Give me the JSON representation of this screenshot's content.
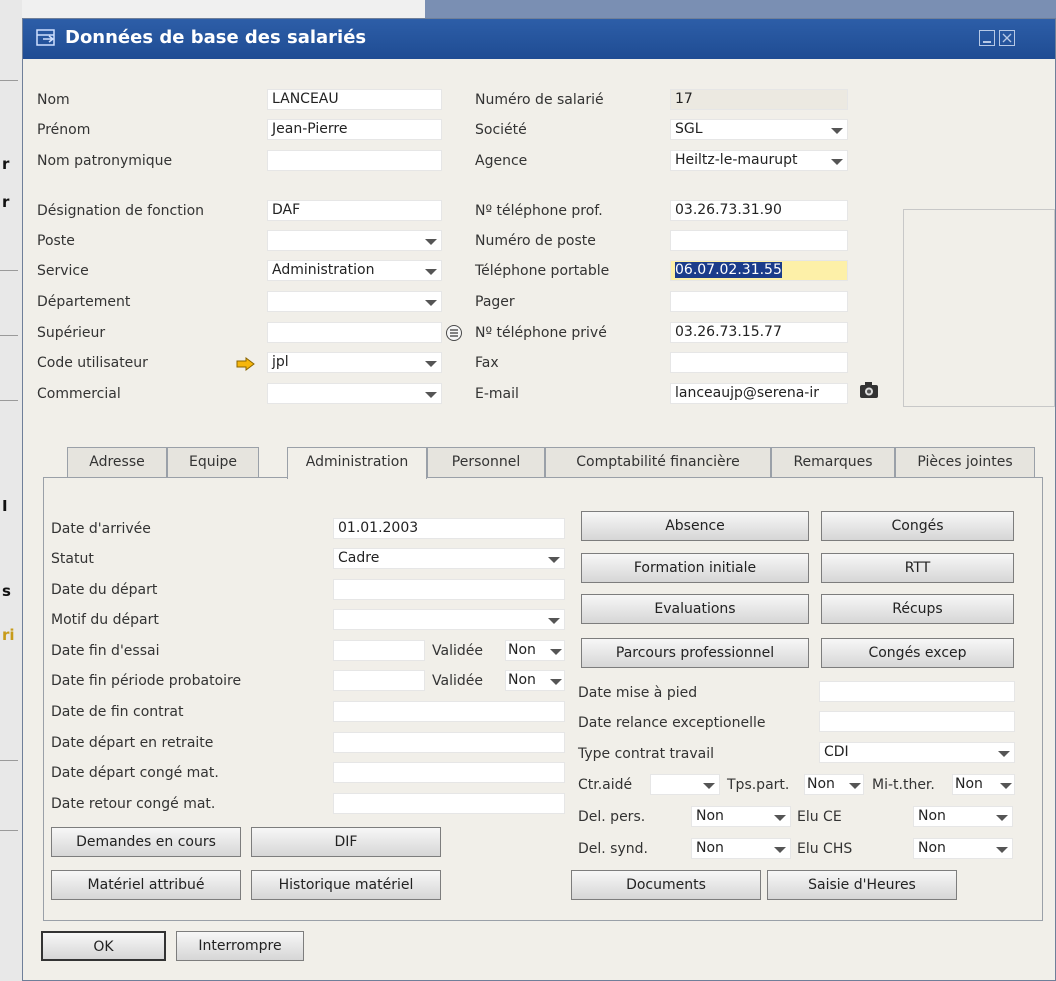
{
  "window": {
    "title": "Données de base des salariés"
  },
  "background": {
    "side_chars": [
      "r",
      "r",
      "I",
      "s",
      "ri"
    ]
  },
  "header_left": [
    {
      "label": "Nom",
      "value": "LANCEAU",
      "type": "text"
    },
    {
      "label": "Prénom",
      "value": "Jean-Pierre",
      "type": "text"
    },
    {
      "label": "Nom patronymique",
      "value": "",
      "type": "text"
    },
    {
      "label": "Désignation de fonction",
      "value": "DAF",
      "type": "text"
    },
    {
      "label": "Poste",
      "value": "",
      "type": "select"
    },
    {
      "label": "Service",
      "value": "Administration",
      "type": "select"
    },
    {
      "label": "Département",
      "value": "",
      "type": "select"
    },
    {
      "label": "Supérieur",
      "value": "",
      "type": "text"
    },
    {
      "label": "Code utilisateur",
      "value": "jpl",
      "type": "select"
    },
    {
      "label": "Commercial",
      "value": "",
      "type": "select"
    }
  ],
  "header_right": [
    {
      "label": "Numéro de salarié",
      "value": "17",
      "type": "readonly"
    },
    {
      "label": "Société",
      "value": "SGL",
      "type": "select"
    },
    {
      "label": "Agence",
      "value": "Heiltz-le-maurupt",
      "type": "select"
    },
    {
      "label": "Nº téléphone prof.",
      "value": "03.26.73.31.90",
      "type": "text"
    },
    {
      "label": "Numéro de poste",
      "value": "",
      "type": "text"
    },
    {
      "label": "Téléphone portable",
      "value": "06.07.02.31.55",
      "type": "highlight"
    },
    {
      "label": "Pager",
      "value": "",
      "type": "text"
    },
    {
      "label": "Nº téléphone privé",
      "value": "03.26.73.15.77",
      "type": "text"
    },
    {
      "label": "Fax",
      "value": "",
      "type": "text"
    },
    {
      "label": "E-mail",
      "value": "lanceaujp@serena-ir",
      "type": "text"
    }
  ],
  "tabs": [
    "Adresse",
    "Equipe",
    "Administration",
    "Personnel",
    "Comptabilité financière",
    "Remarques",
    "Pièces jointes"
  ],
  "active_tab": "Administration",
  "admin_left": [
    {
      "label": "Date d'arrivée",
      "value": "01.01.2003"
    },
    {
      "label": "Statut",
      "value": "Cadre"
    },
    {
      "label": "Date du départ",
      "value": ""
    },
    {
      "label": "Motif du départ",
      "value": ""
    },
    {
      "label": "Date fin d'essai",
      "value": ""
    },
    {
      "label": "Date fin période probatoire",
      "value": ""
    },
    {
      "label": "Date de fin contrat",
      "value": ""
    },
    {
      "label": "Date départ en retraite",
      "value": ""
    },
    {
      "label": "Date départ congé mat.",
      "value": ""
    },
    {
      "label": "Date retour congé mat.",
      "value": ""
    }
  ],
  "validee_label": "Validée",
  "validee_value": "Non",
  "admin_buttons_left": [
    "Demandes en cours",
    "DIF",
    "Matériel attribué",
    "Historique matériel"
  ],
  "admin_buttons_right": [
    "Absence",
    "Congés",
    "Formation initiale",
    "RTT",
    "Evaluations",
    "Récups",
    "Parcours professionnel",
    "Congés excep"
  ],
  "admin_right_fields": [
    {
      "label": "Date mise à pied",
      "value": ""
    },
    {
      "label": "Date relance exceptionelle",
      "value": ""
    },
    {
      "label": "Type contrat travail",
      "value": "CDI"
    }
  ],
  "flags": {
    "ctr_aide_label": "Ctr.aidé",
    "ctr_aide_value": "",
    "tps_part_label": "Tps.part.",
    "tps_part_value": "Non",
    "mi_t_ther_label": "Mi-t.ther.",
    "mi_t_ther_value": "Non",
    "del_pers_label": "Del. pers.",
    "del_pers_value": "Non",
    "elu_ce_label": "Elu CE",
    "elu_ce_value": "Non",
    "del_synd_label": "Del. synd.",
    "del_synd_value": "Non",
    "elu_chs_label": "Elu CHS",
    "elu_chs_value": "Non"
  },
  "bottom_right_buttons": [
    "Documents",
    "Saisie d'Heures"
  ],
  "footer": {
    "ok": "OK",
    "cancel": "Interrompre"
  },
  "colors": {
    "title_bar": "#1f4c93",
    "highlight": "#1b3c8a",
    "phone_bg": "#fdf0a8"
  }
}
